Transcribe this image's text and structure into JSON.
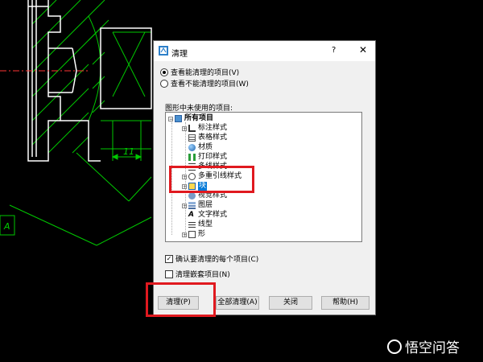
{
  "cad": {
    "dimension_text": "11",
    "view_label": "A"
  },
  "dialog": {
    "title": "清理",
    "help": "?",
    "close": "✕",
    "radio_view_purgeable": "查看能清理的项目(V)",
    "radio_view_nonpurgeable": "查看不能清理的项目(W)",
    "tree_label": "图形中未使用的项目:",
    "tree": {
      "root": "所有项目",
      "items": [
        "标注样式",
        "表格样式",
        "材质",
        "打印样式",
        "多线样式",
        "多重引线样式",
        "块",
        "视觉样式",
        "图层",
        "文字样式",
        "线型",
        "形"
      ]
    },
    "check_confirm": "确认要清理的每个项目(C)",
    "check_nested": "清理嵌套项目(N)",
    "buttons": {
      "purge": "清理(P)",
      "purge_all": "全部清理(A)",
      "close": "关闭",
      "help": "帮助(H)"
    }
  },
  "watermark": "悟空问答",
  "colors": {
    "cad_line": "#ffffff",
    "cad_hatch": "#00d000",
    "highlight": "#e0191f",
    "selection": "#0078d7"
  }
}
